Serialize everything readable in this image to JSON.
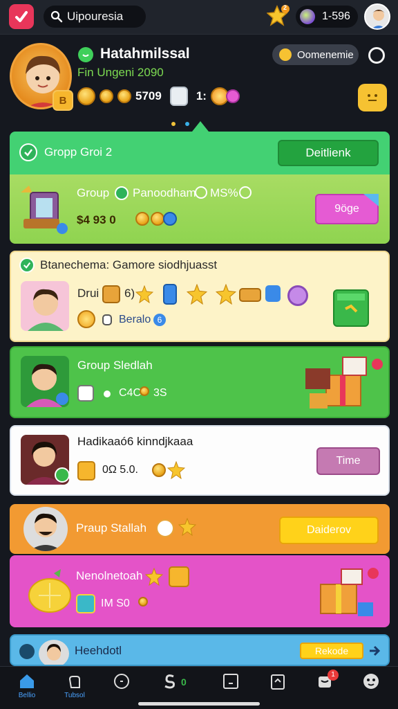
{
  "topbar": {
    "search_text": "Uipouresia",
    "coins": "1-596",
    "star_badge": "2"
  },
  "profile": {
    "name": "Hatahmilssal",
    "subtitle": "Fin Ungeni 2090",
    "badge": "B",
    "stat_1": "5709",
    "stat_2": "1:",
    "comp_label": "Oomenemie"
  },
  "cards": [
    {
      "header_title": "Gropp Groi 2",
      "header_button": "Deitlienk",
      "body_title": "Group",
      "body_sub": "Panoodham",
      "body_tag": "MS%",
      "body_meta": "$4 93 0",
      "body_button": "9öge"
    },
    {
      "title": "Btanechema: Gamore siodhjuasst",
      "row_label": "Drui",
      "row_count": "6)",
      "footer": "Beralo",
      "footer_num": "6"
    },
    {
      "title": "Group Sledlah",
      "meta": "C4C",
      "meta2": "3S"
    },
    {
      "title": "Hadikaaó6 kinndjkaaa",
      "meta": "0Ω 5.0.",
      "button": "Time"
    },
    {
      "title": "Praup Stallah",
      "button": "Daiderov"
    },
    {
      "title": "Nenolnetoah",
      "meta": "IM S0"
    },
    {
      "title": "Heehdotl",
      "button": "Rekode"
    }
  ],
  "nav": {
    "items": [
      {
        "label": "Bellio",
        "icon": "home-icon"
      },
      {
        "label": "Tubsol",
        "icon": "hand-icon"
      },
      {
        "label": "",
        "icon": "circle-icon"
      },
      {
        "label": "",
        "icon": "s-icon"
      },
      {
        "label": "",
        "icon": "square-icon"
      },
      {
        "label": "",
        "icon": "clipboard-icon"
      },
      {
        "label": "",
        "icon": "cup-icon"
      },
      {
        "label": "",
        "icon": "face-icon"
      }
    ],
    "badge": "1",
    "count": "0"
  }
}
